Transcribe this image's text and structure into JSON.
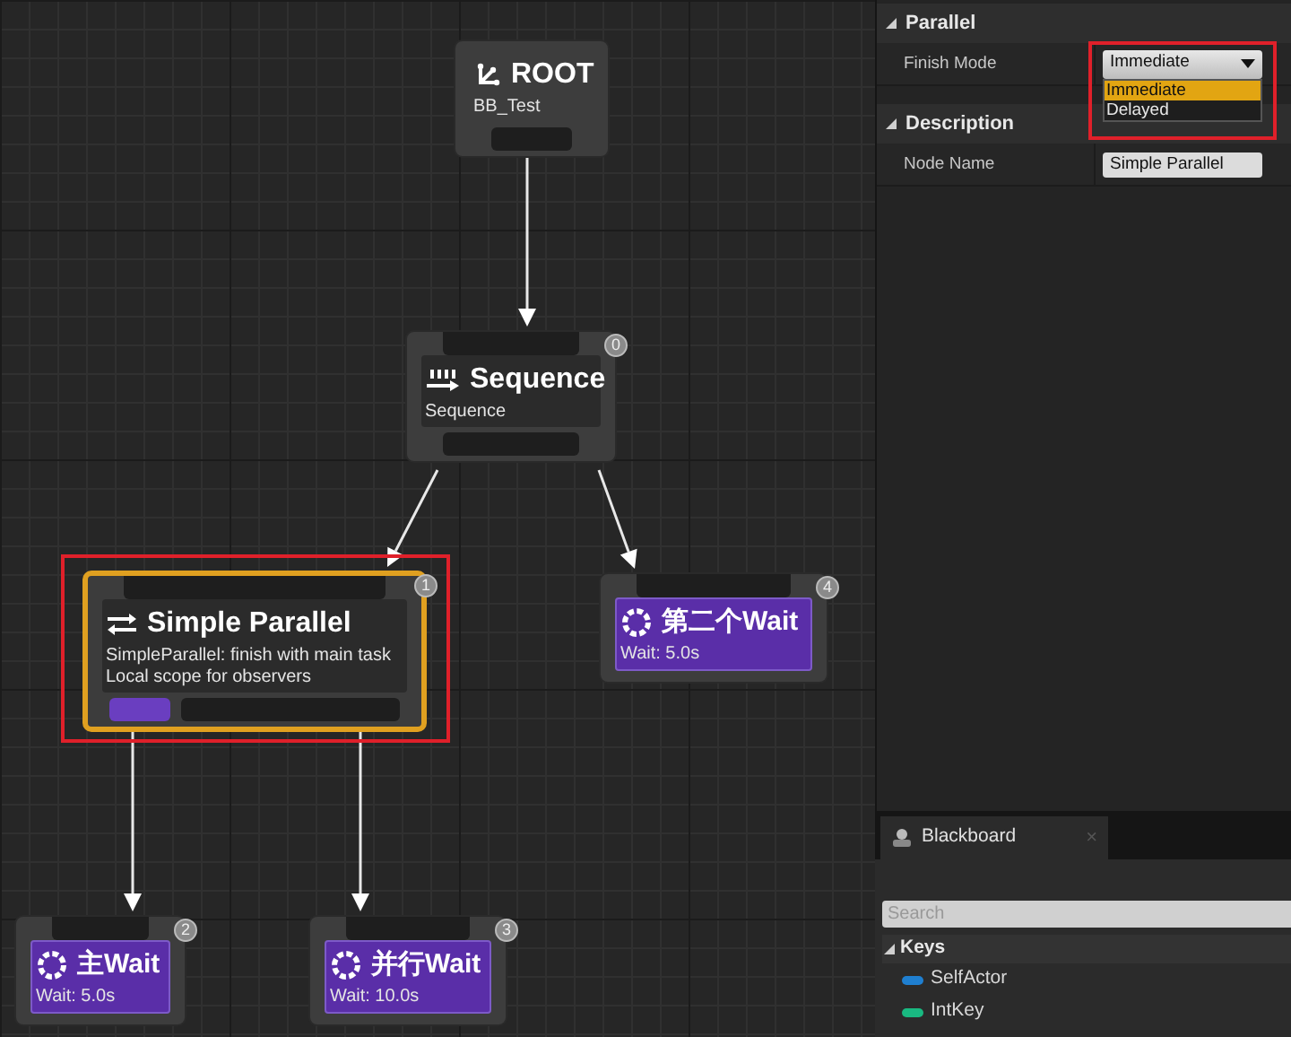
{
  "tree": {
    "kind": "root",
    "title": "ROOT",
    "lines": [
      "BB_Test"
    ],
    "selected": false,
    "children": [
      {
        "kind": "sequence",
        "title": "Sequence",
        "lines": [
          "Sequence"
        ],
        "badge": "0",
        "selected": false,
        "children": [
          {
            "kind": "parallel",
            "title": "Simple Parallel",
            "lines": [
              "SimpleParallel: finish with main task",
              "Local scope for observers"
            ],
            "badge": "1",
            "selected": true,
            "highlighted": true,
            "children": [
              {
                "kind": "wait",
                "title": "主Wait",
                "lines": [
                  "Wait: 5.0s"
                ],
                "badge": "2",
                "selected": false
              },
              {
                "kind": "wait",
                "title": "并行Wait",
                "lines": [
                  "Wait: 10.0s"
                ],
                "badge": "3",
                "selected": false
              }
            ]
          },
          {
            "kind": "wait",
            "title": "第二个Wait",
            "lines": [
              "Wait: 5.0s"
            ],
            "badge": "4",
            "selected": false
          }
        ]
      }
    ]
  },
  "details": {
    "sections": [
      {
        "title": "Parallel",
        "expanded": true,
        "rows": [
          {
            "kind": "dropdown",
            "label": "Finish Mode",
            "value": "Immediate",
            "open": true,
            "highlighted": true,
            "options": [
              {
                "label": "Immediate",
                "selected": true
              },
              {
                "label": "Delayed",
                "selected": false
              }
            ]
          }
        ]
      },
      {
        "title": "Description",
        "expanded": true,
        "rows": [
          {
            "kind": "text",
            "label": "Node Name",
            "value": "Simple Parallel"
          }
        ]
      }
    ]
  },
  "blackboard": {
    "tab": {
      "label": "Blackboard",
      "close": "×"
    },
    "search": {
      "placeholder": "Search"
    },
    "section": {
      "title": "Keys",
      "expanded": true,
      "items": [
        {
          "name": "SelfActor",
          "color": "#1f7fd0"
        },
        {
          "name": "IntKey",
          "color": "#19b981"
        }
      ]
    }
  }
}
